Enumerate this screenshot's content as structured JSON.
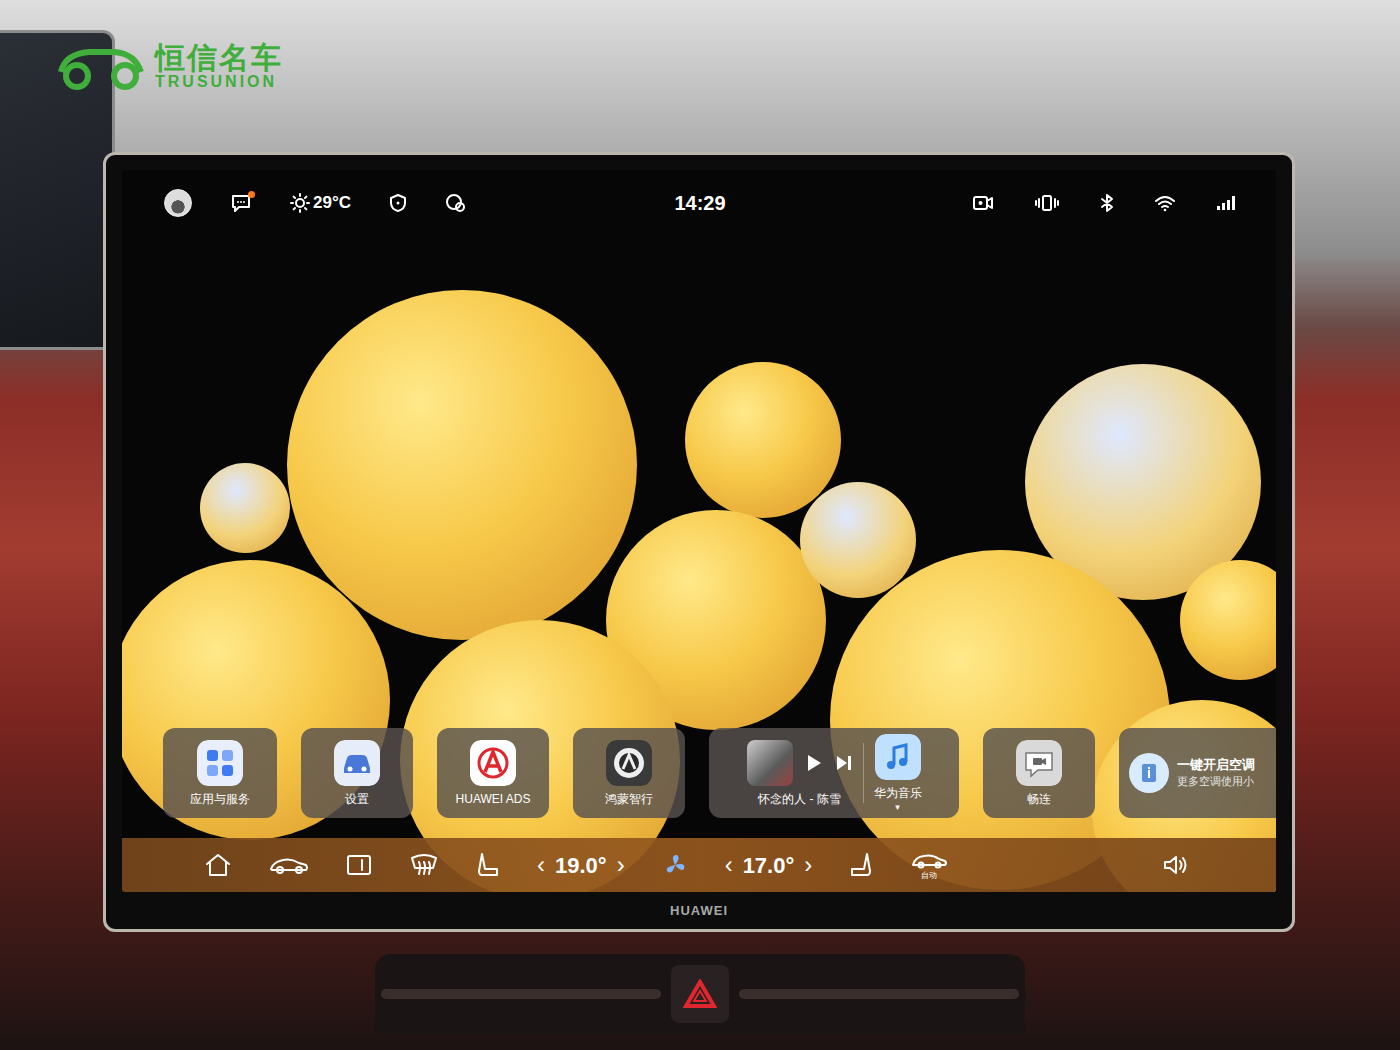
{
  "watermark": {
    "name": "恒信名车",
    "latin": "TRUSUNION"
  },
  "status_bar": {
    "chat_unread": true,
    "weather": "29°C",
    "time": "14:29"
  },
  "dock": [
    {
      "kind": "app",
      "label": "应用与服务"
    },
    {
      "kind": "app",
      "label": "设置"
    },
    {
      "kind": "app",
      "label": "HUAWEI ADS"
    },
    {
      "kind": "app",
      "label": "鸿蒙智行"
    },
    {
      "kind": "media",
      "label": "怀念的人 - 陈雪",
      "playing": false,
      "app_label": "华为音乐",
      "indicator": "▾"
    },
    {
      "kind": "app",
      "label": "畅连"
    },
    {
      "kind": "card",
      "title": "一键开启空调",
      "subtitle": "更多空调使用小"
    }
  ],
  "climate": {
    "decrease": "‹",
    "increase": "›",
    "driver_temp": "19.0°",
    "passenger_temp": "17.0°",
    "auto_label": "自动"
  },
  "brand": "HUAWEI"
}
